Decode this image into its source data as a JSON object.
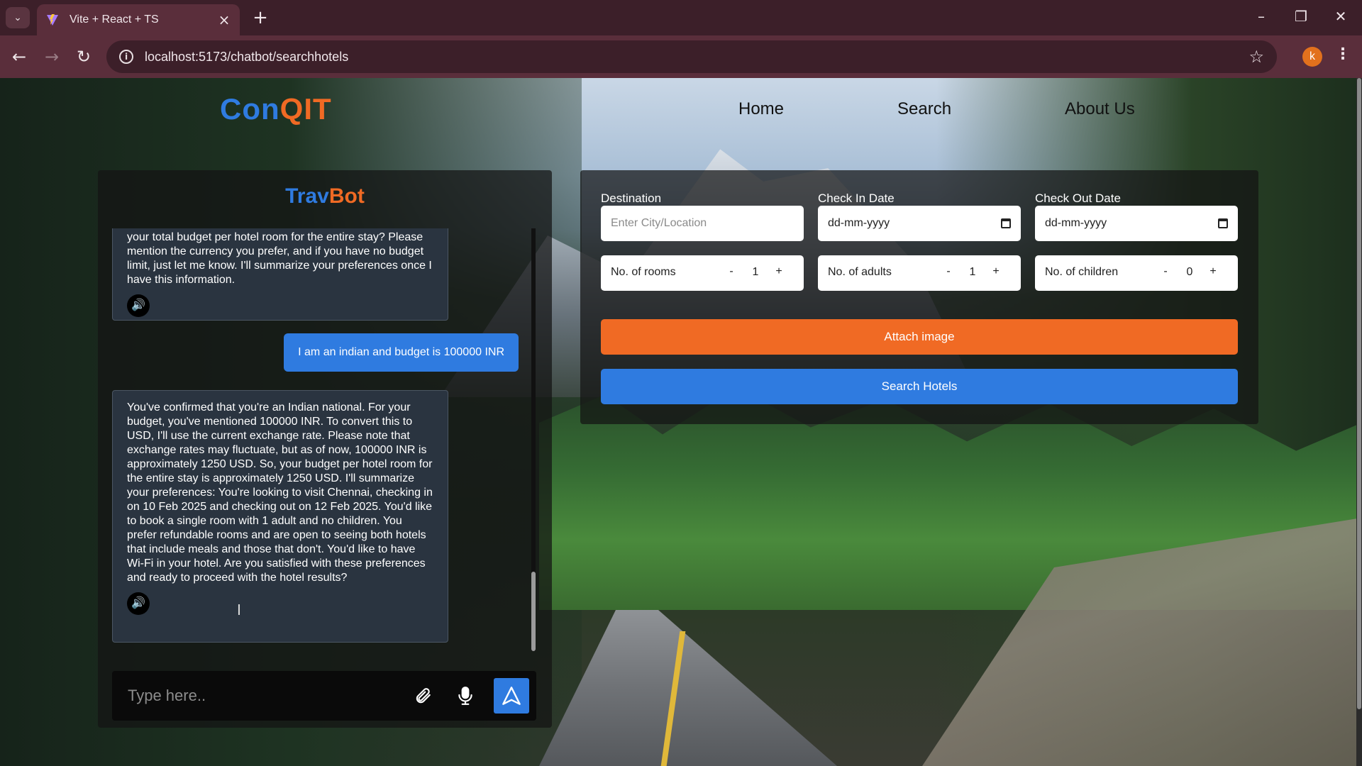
{
  "browser": {
    "tab_title": "Vite + React + TS",
    "url": "localhost:5173/chatbot/searchhotels",
    "profile_initial": "k"
  },
  "header": {
    "logo_part1": "Con",
    "logo_part2": "QIT",
    "nav": [
      "Home",
      "Search",
      "About Us"
    ]
  },
  "chat": {
    "title_part1": "Trav",
    "title_part2": "Bot",
    "messages": [
      {
        "role": "bot",
        "text": "your total budget per hotel room for the entire stay? Please mention the currency you prefer, and if you have no budget limit, just let me know. I'll summarize your preferences once I have this information."
      },
      {
        "role": "user",
        "text": "I am an indian and budget is 100000 INR"
      },
      {
        "role": "bot",
        "text": "You've confirmed that you're an Indian national. For your budget, you've mentioned 100000 INR. To convert this to USD, I'll use the current exchange rate. Please note that exchange rates may fluctuate, but as of now, 100000 INR is approximately 1250 USD. So, your budget per hotel room for the entire stay is approximately 1250 USD. I'll summarize your preferences: You're looking to visit Chennai, checking in on 10 Feb 2025 and checking out on 12 Feb 2025. You'd like to book a single room with 1 adult and no children. You prefer refundable rooms and are open to seeing both hotels that include meals and those that don't. You'd like to have Wi-Fi in your hotel. Are you satisfied with these preferences and ready to proceed with the hotel results?"
      }
    ],
    "input_placeholder": "Type here.."
  },
  "search": {
    "destination_label": "Destination",
    "destination_placeholder": "Enter City/Location",
    "checkin_label": "Check In Date",
    "checkin_value": "dd-mm-yyyy",
    "checkout_label": "Check Out Date",
    "checkout_value": "dd-mm-yyyy",
    "rooms": {
      "label": "No. of rooms",
      "value": "1"
    },
    "adults": {
      "label": "No. of adults",
      "value": "1"
    },
    "children": {
      "label": "No. of children",
      "value": "0"
    },
    "minus": "-",
    "plus": "+",
    "attach_label": "Attach image",
    "search_label": "Search Hotels"
  },
  "colors": {
    "brand_blue": "#2f7be0",
    "brand_orange": "#f06a24"
  }
}
